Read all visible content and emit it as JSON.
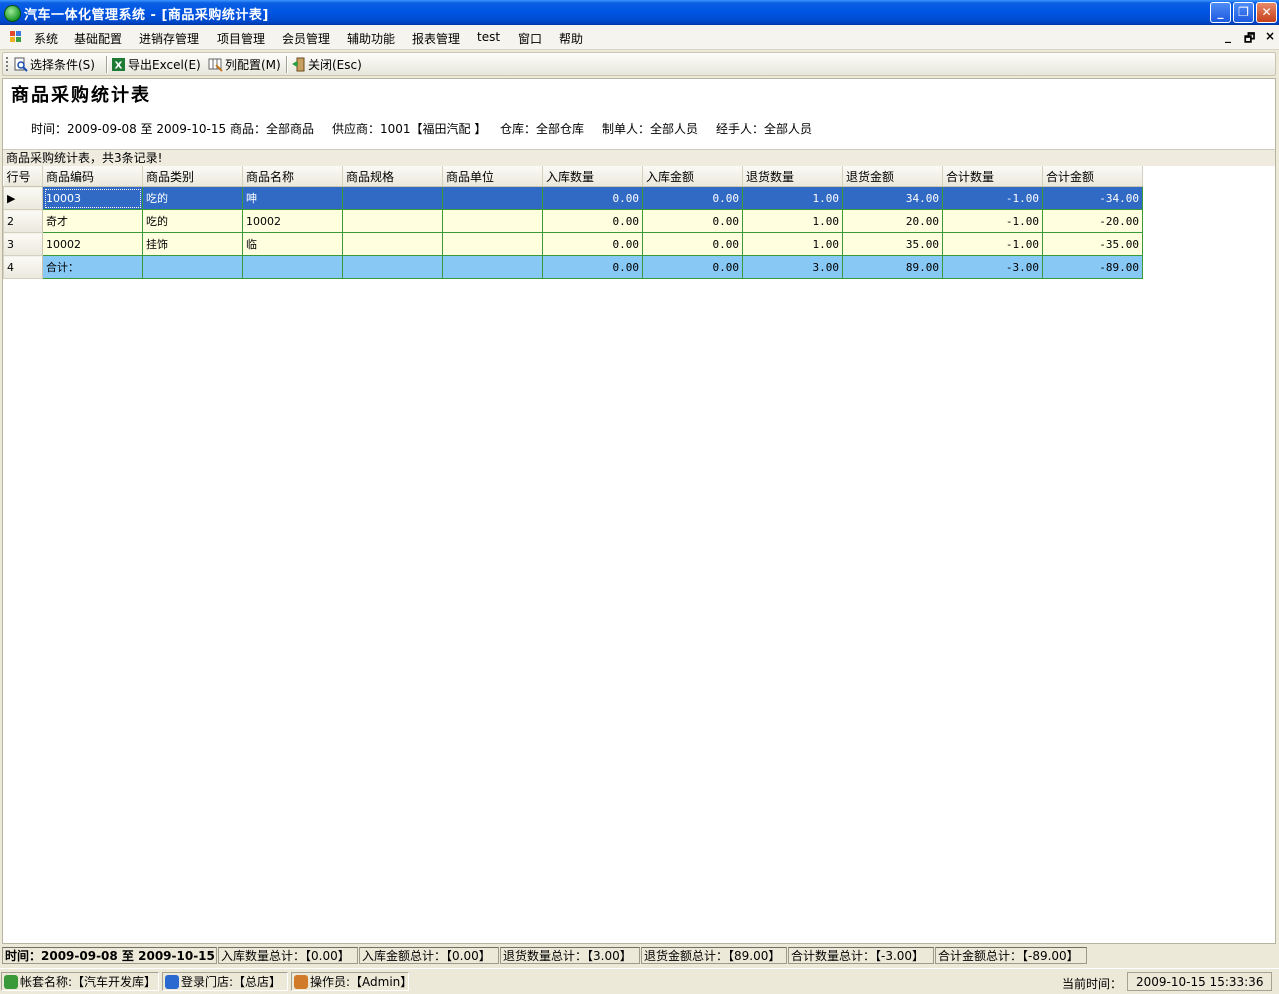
{
  "window": {
    "title": "汽车一体化管理系统 - [商品采购统计表]",
    "minimize_glyph": "_",
    "restore_glyph": "❐",
    "close_glyph": "✕"
  },
  "menu": {
    "items": [
      "系统",
      "基础配置",
      "进销存管理",
      "项目管理",
      "会员管理",
      "辅助功能",
      "报表管理",
      "test",
      "窗口",
      "帮助"
    ],
    "mdi_minimize": "_",
    "mdi_restore": "🗗",
    "mdi_close": "×"
  },
  "toolbar": {
    "select_condition": "选择条件(S)",
    "export_excel": "导出Excel(E)",
    "column_config": "列配置(M)",
    "close": "关闭(Esc)"
  },
  "report": {
    "title": "商品采购统计表",
    "filters": {
      "time": "时间：2009-09-08 至 2009-10-15",
      "product": "商品：全部商品",
      "supplier": "供应商：1001【福田汽配 】",
      "warehouse": "仓库：全部仓库",
      "creator": "制单人：全部人员",
      "handler": "经手人：全部人员"
    },
    "caption": "商品采购统计表，共3条记录!"
  },
  "grid": {
    "columns": [
      "行号",
      "商品编码",
      "商品类别",
      "商品名称",
      "商品规格",
      "商品单位",
      "入库数量",
      "入库金额",
      "退货数量",
      "退货金额",
      "合计数量",
      "合计金额"
    ],
    "rows": [
      {
        "row": "▶",
        "code": "10003",
        "category": "吃的",
        "name": "呻",
        "spec": "",
        "unit": "",
        "in_qty": "0.00",
        "in_amt": "0.00",
        "ret_qty": "1.00",
        "ret_amt": "34.00",
        "tot_qty": "-1.00",
        "tot_amt": "-34.00"
      },
      {
        "row": "2",
        "code": "奇才",
        "category": "吃的",
        "name": "10002",
        "spec": "",
        "unit": "",
        "in_qty": "0.00",
        "in_amt": "0.00",
        "ret_qty": "1.00",
        "ret_amt": "20.00",
        "tot_qty": "-1.00",
        "tot_amt": "-20.00"
      },
      {
        "row": "3",
        "code": "10002",
        "category": "挂饰",
        "name": "临",
        "spec": "",
        "unit": "",
        "in_qty": "0.00",
        "in_amt": "0.00",
        "ret_qty": "1.00",
        "ret_amt": "35.00",
        "tot_qty": "-1.00",
        "tot_amt": "-35.00"
      },
      {
        "row": "4",
        "code": "合计：",
        "category": "",
        "name": "",
        "spec": "",
        "unit": "",
        "in_qty": "0.00",
        "in_amt": "0.00",
        "ret_qty": "3.00",
        "ret_amt": "89.00",
        "tot_qty": "-3.00",
        "tot_amt": "-89.00"
      }
    ]
  },
  "summary": {
    "time": "时间：2009-09-08 至 2009-10-15",
    "in_qty_total": "入库数量总计：【0.00】",
    "in_amt_total": "入库金额总计：【0.00】",
    "ret_qty_total": "退货数量总计：【3.00】",
    "ret_amt_total": "退货金额总计：【89.00】",
    "tot_qty_total": "合计数量总计：【-3.00】",
    "tot_amt_total": "合计金额总计：【-89.00】"
  },
  "status": {
    "account": "帐套名称:【汽车开发库】",
    "store": "登录门店:【总店】",
    "operator": "操作员:【Admin】",
    "current_time_label": "当前时间：",
    "current_time": "2009-10-15 15:33:36"
  },
  "colors": {
    "titlebar": "#0054e3",
    "selected_row": "#316ac5",
    "normal_row": "#ffffe0",
    "total_row": "#87c8f5",
    "grid_line": "#3a9a3a"
  }
}
